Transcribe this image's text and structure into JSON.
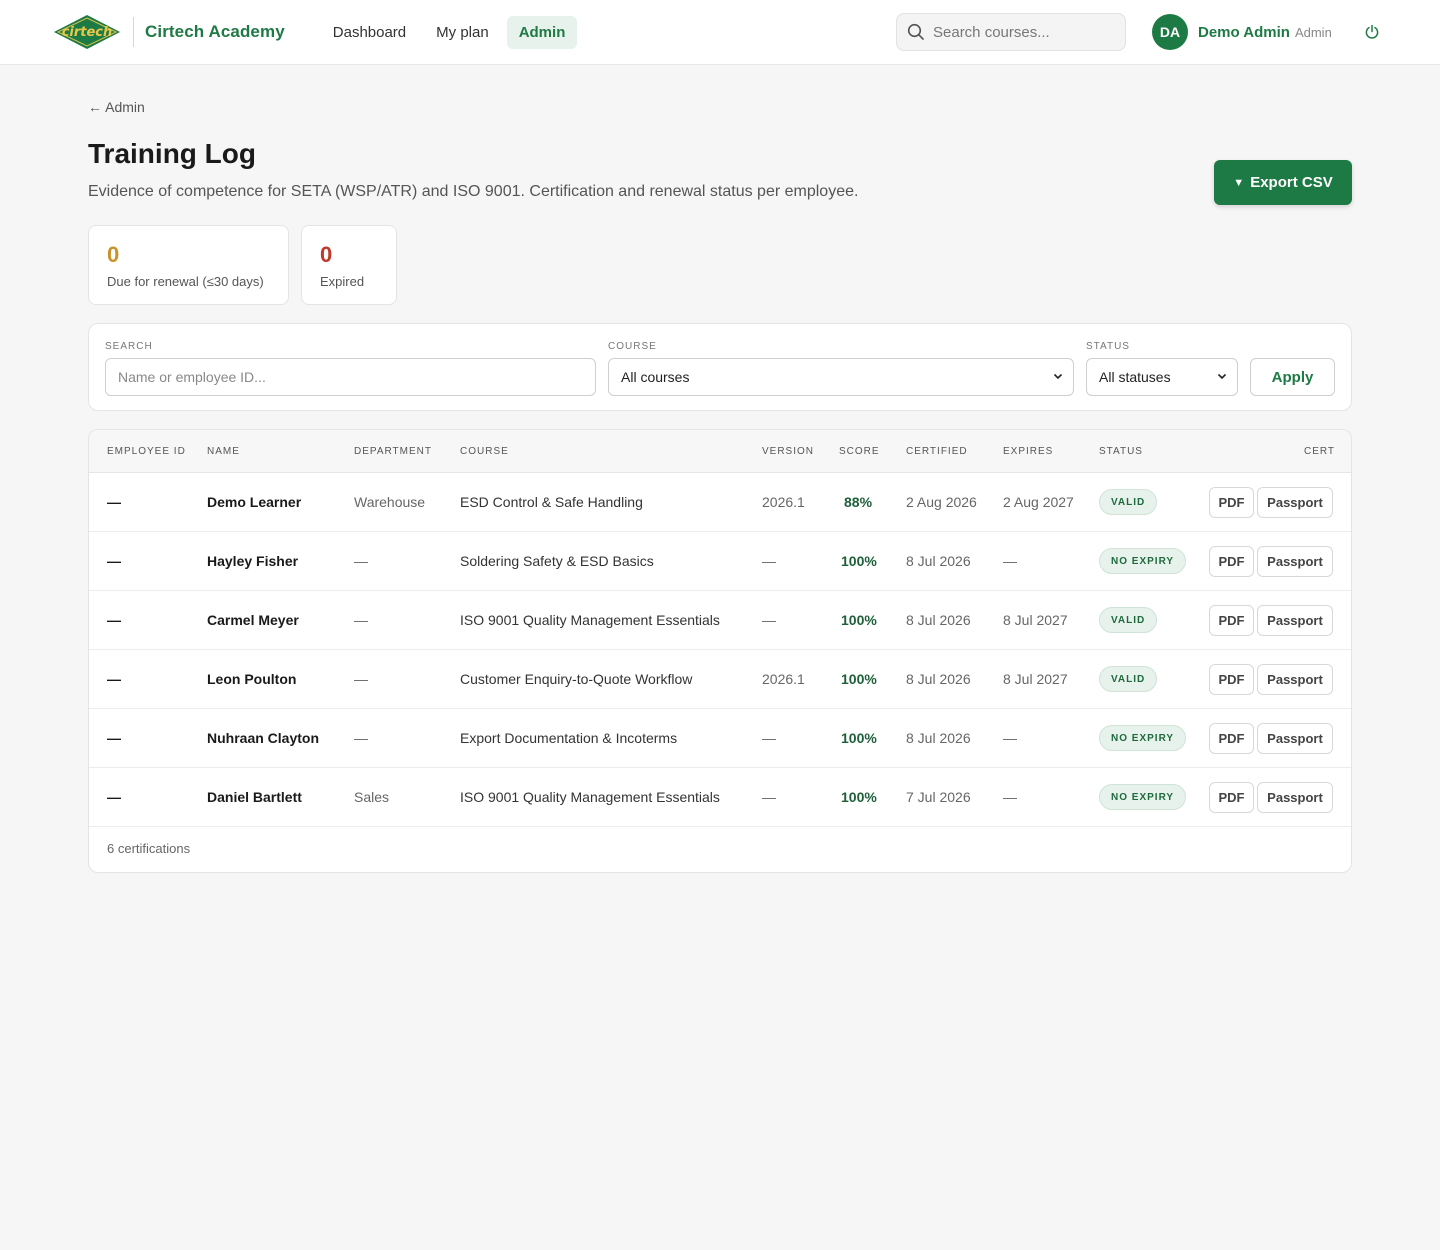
{
  "header": {
    "brand": "Cirtech Academy",
    "logo_text": "cirtech",
    "nav": [
      {
        "label": "Dashboard",
        "active": false
      },
      {
        "label": "My plan",
        "active": false
      },
      {
        "label": "Admin",
        "active": true
      }
    ],
    "search_placeholder": "Search courses...",
    "user": {
      "initials": "DA",
      "name": "Demo Admin",
      "role": "Admin"
    }
  },
  "page": {
    "back_label": "← Admin",
    "title": "Training Log",
    "subtitle": "Evidence of competence for SETA (WSP/ATR) and ISO 9001. Certification and renewal status per employee.",
    "export_label": "Export CSV"
  },
  "stats": {
    "due": {
      "value": "0",
      "label": "Due for renewal (≤30 days)",
      "color": "#c9932a"
    },
    "expired": {
      "value": "0",
      "label": "Expired",
      "color": "#c0392b"
    }
  },
  "filters": {
    "search_label": "SEARCH",
    "search_placeholder": "Name or employee ID...",
    "course_label": "COURSE",
    "course_value": "All courses",
    "status_label": "STATUS",
    "status_value": "All statuses",
    "apply_label": "Apply"
  },
  "table": {
    "columns": [
      "EMPLOYEE ID",
      "NAME",
      "DEPARTMENT",
      "COURSE",
      "VERSION",
      "SCORE",
      "CERTIFIED",
      "EXPIRES",
      "STATUS",
      "CERT"
    ],
    "rows": [
      {
        "id": "—",
        "name": "Demo Learner",
        "department": "Warehouse",
        "course": "ESD Control & Safe Handling",
        "version": "2026.1",
        "score": "88%",
        "certified": "2 Aug 2026",
        "expires": "2 Aug 2027",
        "status": "VALID"
      },
      {
        "id": "—",
        "name": "Hayley Fisher",
        "department": "—",
        "course": "Soldering Safety & ESD Basics",
        "version": "—",
        "score": "100%",
        "certified": "8 Jul 2026",
        "expires": "—",
        "status": "NO EXPIRY"
      },
      {
        "id": "—",
        "name": "Carmel Meyer",
        "department": "—",
        "course": "ISO 9001 Quality Management Essentials",
        "version": "—",
        "score": "100%",
        "certified": "8 Jul 2026",
        "expires": "8 Jul 2027",
        "status": "VALID"
      },
      {
        "id": "—",
        "name": "Leon Poulton",
        "department": "—",
        "course": "Customer Enquiry-to-Quote Workflow",
        "version": "2026.1",
        "score": "100%",
        "certified": "8 Jul 2026",
        "expires": "8 Jul 2027",
        "status": "VALID"
      },
      {
        "id": "—",
        "name": "Nuhraan Clayton",
        "department": "—",
        "course": "Export Documentation & Incoterms",
        "version": "—",
        "score": "100%",
        "certified": "8 Jul 2026",
        "expires": "—",
        "status": "NO EXPIRY"
      },
      {
        "id": "—",
        "name": "Daniel Bartlett",
        "department": "Sales",
        "course": "ISO 9001 Quality Management Essentials",
        "version": "—",
        "score": "100%",
        "certified": "7 Jul 2026",
        "expires": "—",
        "status": "NO EXPIRY"
      }
    ],
    "pdf_label": "PDF",
    "passport_label": "Passport",
    "footer": "6 certifications"
  }
}
